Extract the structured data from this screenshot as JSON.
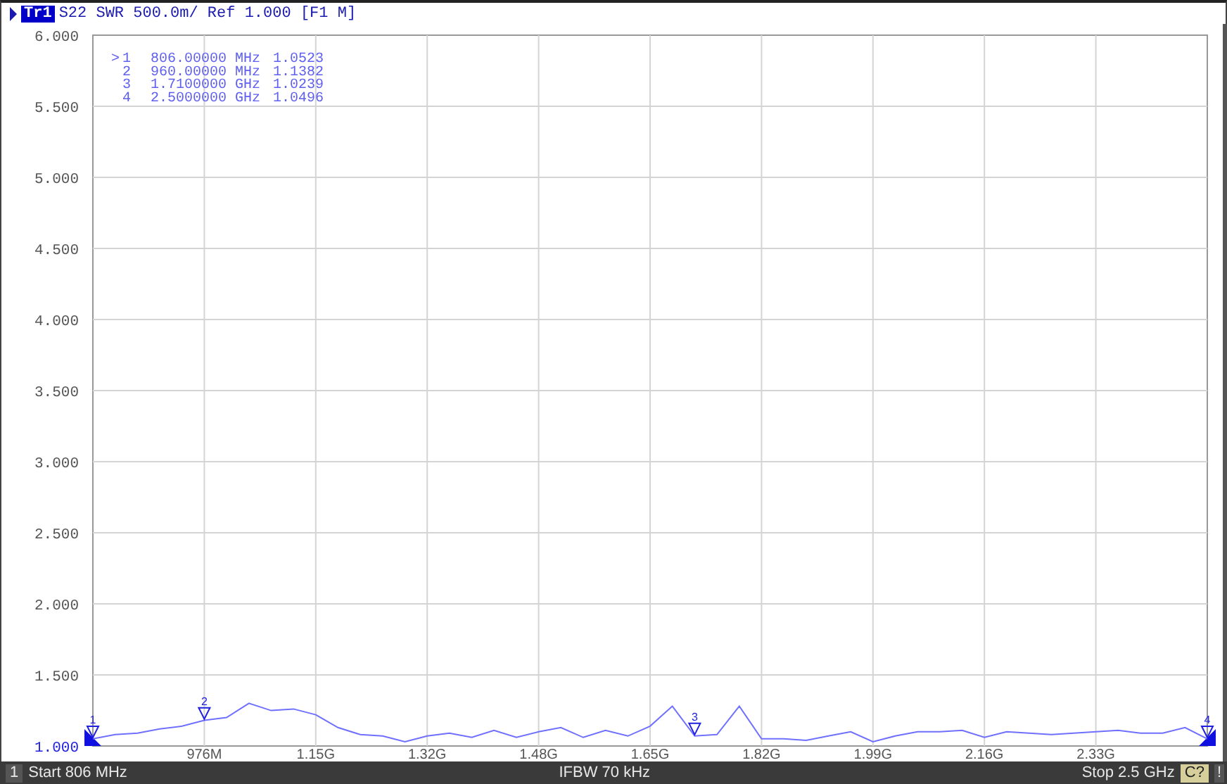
{
  "header": {
    "trace": {
      "selected": true
    },
    "trace_info": "S22 SWR 500.0m/ Ref 1.000 [F1 M]"
  },
  "marker_table": {
    "active_symbol": ">",
    "rows": [
      {
        "number": "1",
        "stimulus": "806.00000",
        "unit": "MHz",
        "response": "1.0523",
        "selected": true
      },
      {
        "number": "2",
        "stimulus": "960.00000",
        "unit": "MHz",
        "response": "1.1382",
        "selected": false
      },
      {
        "number": "3",
        "stimulus": "1.7100000",
        "unit": "GHz",
        "response": "1.0239",
        "selected": false
      },
      {
        "number": "4",
        "stimulus": "2.5000000",
        "unit": "GHz",
        "response": "1.0496",
        "selected": false
      }
    ]
  },
  "chart_data": {
    "type": "line",
    "ylim": [
      1,
      6
    ],
    "yticks": [
      {
        "value": 6,
        "label": "6.000"
      },
      {
        "value": 5.5,
        "label": "5.500"
      },
      {
        "value": 5,
        "label": "5.000"
      },
      {
        "value": 4.5,
        "label": "4.500"
      },
      {
        "value": 4,
        "label": "4.000"
      },
      {
        "value": 3.5,
        "label": "3.500"
      },
      {
        "value": 3,
        "label": "3.000"
      },
      {
        "value": 2.5,
        "label": "2.500"
      },
      {
        "value": 2,
        "label": "2.000"
      },
      {
        "value": 1.5,
        "label": "1.500"
      },
      {
        "value": 1,
        "label": "1.000"
      }
    ],
    "categories": [
      null,
      null,
      null,
      null,
      null,
      "976M",
      null,
      null,
      null,
      null,
      "1.15G",
      null,
      null,
      null,
      null,
      "1.32G",
      null,
      null,
      null,
      null,
      "1.48G",
      null,
      null,
      null,
      null,
      "1.65G",
      null,
      null,
      null,
      null,
      "1.82G",
      null,
      null,
      null,
      null,
      "1.99G",
      null,
      null,
      null,
      null,
      "2.16G",
      null,
      null,
      null,
      null,
      "2.33G",
      null,
      null,
      null,
      null,
      null
    ],
    "series": [
      {
        "name": "Tr1",
        "color": "#7070ff",
        "values": [
          1.05,
          1.08,
          1.09,
          1.12,
          1.14,
          1.18,
          1.2,
          1.3,
          1.25,
          1.26,
          1.22,
          1.13,
          1.08,
          1.07,
          1.03,
          1.07,
          1.09,
          1.06,
          1.11,
          1.06,
          1.1,
          1.13,
          1.06,
          1.11,
          1.07,
          1.14,
          1.28,
          1.07,
          1.08,
          1.28,
          1.05,
          1.05,
          1.04,
          1.07,
          1.1,
          1.03,
          1.07,
          1.1,
          1.1,
          1.11,
          1.06,
          1.1,
          1.09,
          1.08,
          1.09,
          1.1,
          1.11,
          1.09,
          1.09,
          1.13,
          1.05
        ]
      }
    ],
    "annotations": [
      "1",
      "2",
      "3",
      "4"
    ],
    "grid": true
  },
  "status_bar": {
    "channel": "1",
    "start": "Start 806 MHz",
    "ifbw": "IFBW 70 kHz",
    "stop": "Stop 2.5 GHz",
    "calibration": "C?",
    "warning": "!"
  }
}
